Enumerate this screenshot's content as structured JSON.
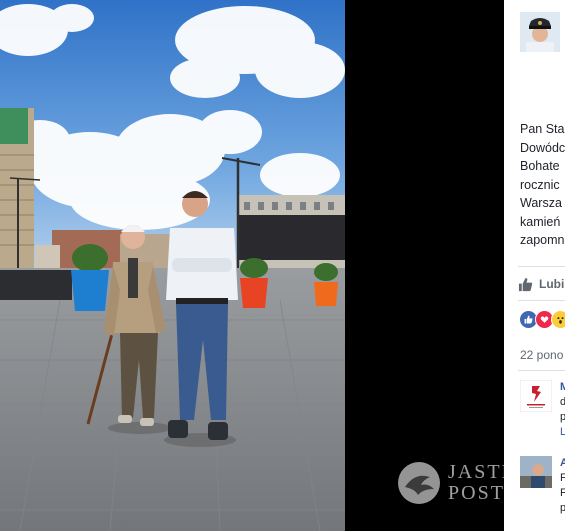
{
  "post": {
    "text_lines": [
      "Pan Sta",
      "Dowódc",
      "Bohate",
      "rocznic",
      "Warsza",
      "kamień",
      "zapomn"
    ],
    "like_label": "Lubi",
    "shares": "22 pono"
  },
  "comments": [
    {
      "name": "M",
      "lines": [
        "d",
        "p"
      ],
      "reply": "L"
    },
    {
      "name": "A",
      "lines": [
        "F",
        "F",
        "p"
      ]
    }
  ],
  "watermark": {
    "line1": "JASTRAB",
    "line2": "POST"
  },
  "colors": {
    "fb_blue": "#4267b2",
    "love_red": "#f0284a",
    "wow_yellow": "#fbcd3c",
    "link": "#385898"
  },
  "icons": {
    "like": "thumbs-up-icon",
    "reaction_like": "like-reaction-icon",
    "reaction_love": "love-reaction-icon",
    "reaction_wow": "wow-reaction-icon"
  }
}
